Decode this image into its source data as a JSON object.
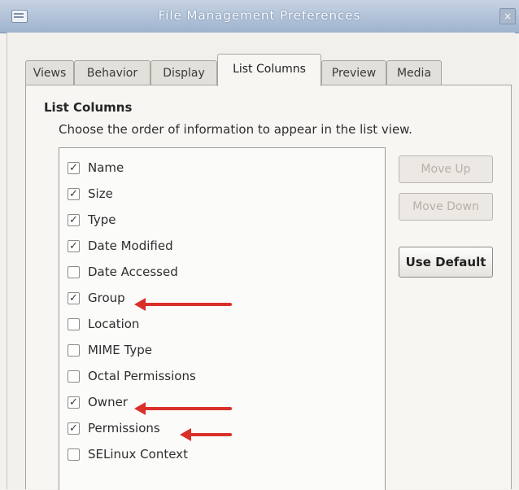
{
  "window": {
    "title": "File Management Preferences",
    "close_glyph": "×"
  },
  "tabs": [
    {
      "label": "Views",
      "active": false
    },
    {
      "label": "Behavior",
      "active": false
    },
    {
      "label": "Display",
      "active": false
    },
    {
      "label": "List Columns",
      "active": true
    },
    {
      "label": "Preview",
      "active": false
    },
    {
      "label": "Media",
      "active": false
    }
  ],
  "panel": {
    "section_title": "List Columns",
    "description": "Choose the order of information to appear in the list view."
  },
  "columns": [
    {
      "label": "Name",
      "checked": true
    },
    {
      "label": "Size",
      "checked": true
    },
    {
      "label": "Type",
      "checked": true
    },
    {
      "label": "Date Modified",
      "checked": true
    },
    {
      "label": "Date Accessed",
      "checked": false
    },
    {
      "label": "Group",
      "checked": true,
      "highlighted": true
    },
    {
      "label": "Location",
      "checked": false
    },
    {
      "label": "MIME Type",
      "checked": false
    },
    {
      "label": "Octal Permissions",
      "checked": false
    },
    {
      "label": "Owner",
      "checked": true,
      "highlighted": true
    },
    {
      "label": "Permissions",
      "checked": true,
      "highlighted": true
    },
    {
      "label": "SELinux Context",
      "checked": false
    }
  ],
  "buttons": {
    "move_up": {
      "label": "Move Up",
      "enabled": false
    },
    "move_down": {
      "label": "Move Down",
      "enabled": false
    },
    "use_default": {
      "label": "Use Default",
      "enabled": true
    }
  },
  "colors": {
    "annotation_arrow": "#d9302a",
    "titlebar": "#9fb3cf"
  },
  "icons": {
    "check": "✓",
    "window_menu": "window-menu-icon",
    "close": "close-icon"
  }
}
